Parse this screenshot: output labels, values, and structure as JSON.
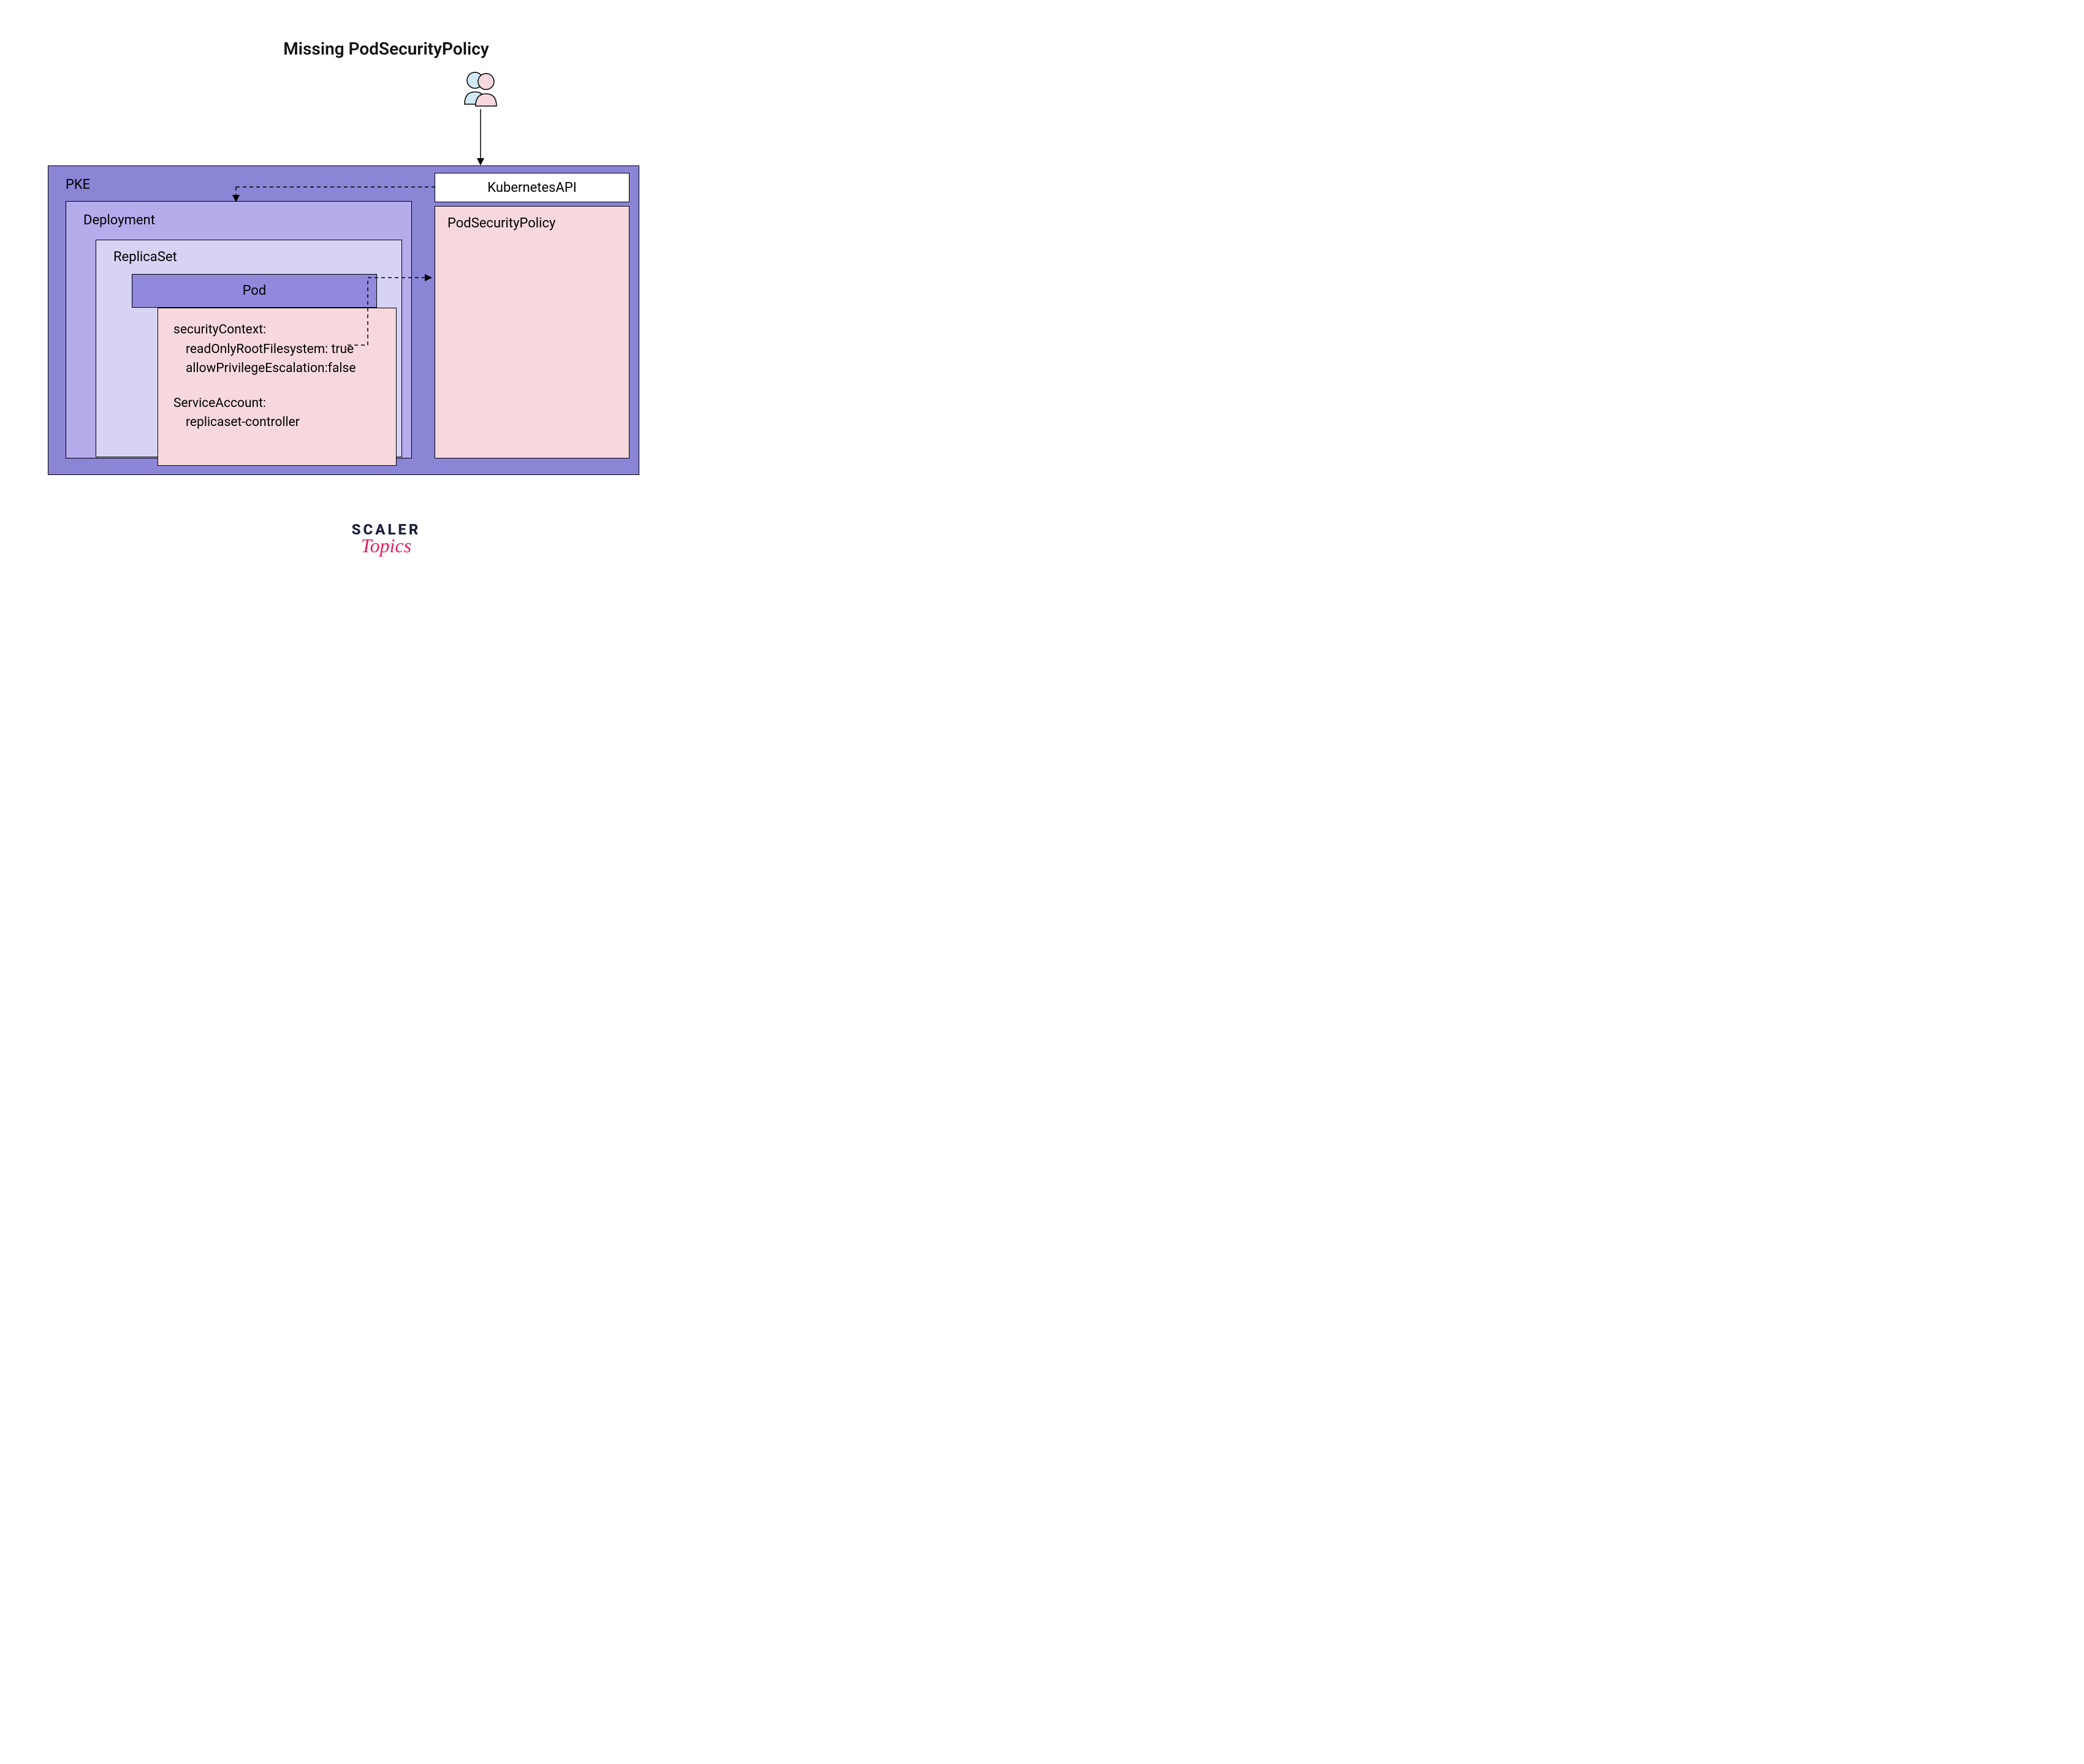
{
  "title": "Missing PodSecurityPolicy",
  "pke": {
    "label": "PKE",
    "deployment": {
      "label": "Deployment",
      "replicaset": {
        "label": "ReplicaSet",
        "pod": {
          "header": "Pod",
          "securityContext": {
            "title": "securityContext:",
            "line1": "readOnlyRootFilesystem: true",
            "line2": "allowPrivilegeEscalation:false"
          },
          "serviceAccount": {
            "title": "ServiceAccount:",
            "value": "replicaset-controller"
          }
        }
      }
    },
    "kubernetesApi": "KubernetesAPI",
    "podSecurityPolicy": "PodSecurityPolicy"
  },
  "logo": {
    "top": "SCALER",
    "bottom": "Topics"
  }
}
